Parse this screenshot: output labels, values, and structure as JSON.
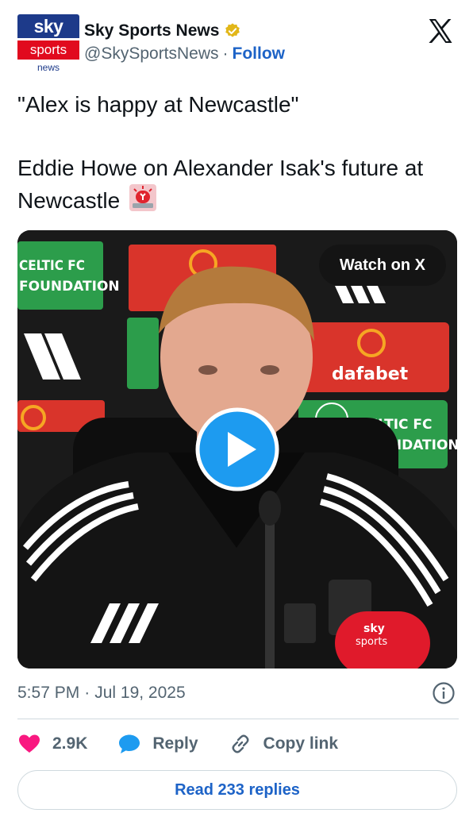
{
  "account": {
    "logo_text": {
      "top": "sky",
      "middle": "sports",
      "bottom": "news"
    },
    "display_name": "Sky Sports News",
    "handle": "@SkySportsNews",
    "separator": "·",
    "follow_label": "Follow",
    "verified_icon": "gold-verified-badge-icon"
  },
  "platform_icon": "x-logo-icon",
  "tweet": {
    "line1": "\"Alex is happy at Newcastle\"",
    "line2": "Eddie Howe on Alexander Isak's future at Newcastle",
    "emoji": "police-light-emoji-icon"
  },
  "media": {
    "watch_label": "Watch on X",
    "play_icon": "play-icon",
    "backdrop_text": {
      "celtic_line1": "CELTIC FC",
      "celtic_line2": "FOUNDATION",
      "sponsor": "dafabet",
      "mic_top": "sky",
      "mic_bottom": "sports"
    }
  },
  "meta": {
    "time": "5:57 PM",
    "separator": "·",
    "date": "Jul 19, 2025",
    "info_icon": "info-icon"
  },
  "actions": {
    "like_count": "2.9K",
    "reply_label": "Reply",
    "copy_label": "Copy link"
  },
  "read_replies_label": "Read 233 replies",
  "colors": {
    "link_blue": "#1d63c7",
    "like_pink": "#f91880",
    "secondary_text": "#536471",
    "play_blue": "#1d9bf0"
  }
}
